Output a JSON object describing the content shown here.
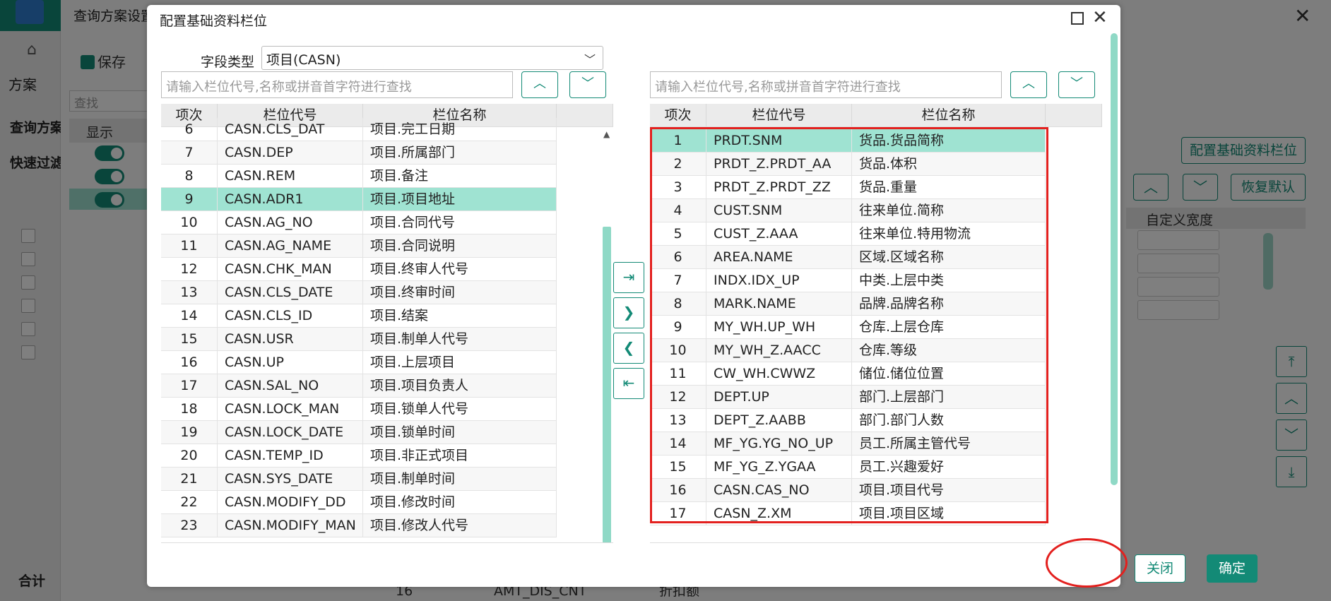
{
  "background": {
    "scheme_label": "方案",
    "window_title": "查询方案设置",
    "save_label": "保存",
    "find_placeholder": "查找",
    "show_header": "显示",
    "query_scheme_label": "查询方案",
    "fast_filter_label": "快速过滤",
    "total_label": "合计",
    "config_button": "配置基础资料栏位",
    "restore_button": "恢复默认",
    "custom_width_header": "自定义宽度",
    "bottom_row": {
      "index": "16",
      "code": "AMT_DIS_CNT",
      "name": "折扣额"
    }
  },
  "dialog": {
    "title": "配置基础资料栏位",
    "field_type_label": "字段类型",
    "field_type_value": "项目(CASN)",
    "search_placeholder": "请输入栏位代号,名称或拼音首字符进行查找",
    "columns": [
      "项次",
      "栏位代号",
      "栏位名称"
    ],
    "left_rows": [
      {
        "idx": "6",
        "code": "CASN.CLS_DAT",
        "name": "项目.完工日期"
      },
      {
        "idx": "7",
        "code": "CASN.DEP",
        "name": "项目.所属部门"
      },
      {
        "idx": "8",
        "code": "CASN.REM",
        "name": "项目.备注"
      },
      {
        "idx": "9",
        "code": "CASN.ADR1",
        "name": "项目.项目地址"
      },
      {
        "idx": "10",
        "code": "CASN.AG_NO",
        "name": "项目.合同代号"
      },
      {
        "idx": "11",
        "code": "CASN.AG_NAME",
        "name": "项目.合同说明"
      },
      {
        "idx": "12",
        "code": "CASN.CHK_MAN",
        "name": "项目.终审人代号"
      },
      {
        "idx": "13",
        "code": "CASN.CLS_DATE",
        "name": "项目.终审时间"
      },
      {
        "idx": "14",
        "code": "CASN.CLS_ID",
        "name": "项目.结案"
      },
      {
        "idx": "15",
        "code": "CASN.USR",
        "name": "项目.制单人代号"
      },
      {
        "idx": "16",
        "code": "CASN.UP",
        "name": "项目.上层项目"
      },
      {
        "idx": "17",
        "code": "CASN.SAL_NO",
        "name": "项目.项目负责人"
      },
      {
        "idx": "18",
        "code": "CASN.LOCK_MAN",
        "name": "项目.锁单人代号"
      },
      {
        "idx": "19",
        "code": "CASN.LOCK_DATE",
        "name": "项目.锁单时间"
      },
      {
        "idx": "20",
        "code": "CASN.TEMP_ID",
        "name": "项目.非正式项目"
      },
      {
        "idx": "21",
        "code": "CASN.SYS_DATE",
        "name": "项目.制单时间"
      },
      {
        "idx": "22",
        "code": "CASN.MODIFY_DD",
        "name": "项目.修改时间"
      },
      {
        "idx": "23",
        "code": "CASN.MODIFY_MAN",
        "name": "项目.修改人代号"
      }
    ],
    "left_selected_index": 3,
    "right_rows": [
      {
        "idx": "1",
        "code": "PRDT.SNM",
        "name": "货品.货品简称"
      },
      {
        "idx": "2",
        "code": "PRDT_Z.PRDT_AA",
        "name": "货品.体积"
      },
      {
        "idx": "3",
        "code": "PRDT_Z.PRDT_ZZ",
        "name": "货品.重量"
      },
      {
        "idx": "4",
        "code": "CUST.SNM",
        "name": "往来单位.简称"
      },
      {
        "idx": "5",
        "code": "CUST_Z.AAA",
        "name": "往来单位.特用物流"
      },
      {
        "idx": "6",
        "code": "AREA.NAME",
        "name": "区域.区域名称"
      },
      {
        "idx": "7",
        "code": "INDX.IDX_UP",
        "name": "中类.上层中类"
      },
      {
        "idx": "8",
        "code": "MARK.NAME",
        "name": "品牌.品牌名称"
      },
      {
        "idx": "9",
        "code": "MY_WH.UP_WH",
        "name": "仓库.上层仓库"
      },
      {
        "idx": "10",
        "code": "MY_WH_Z.AACC",
        "name": "仓库.等级"
      },
      {
        "idx": "11",
        "code": "CW_WH.CWWZ",
        "name": "储位.储位位置"
      },
      {
        "idx": "12",
        "code": "DEPT.UP",
        "name": "部门.上层部门"
      },
      {
        "idx": "13",
        "code": "DEPT_Z.AABB",
        "name": "部门.部门人数"
      },
      {
        "idx": "14",
        "code": "MF_YG.YG_NO_UP",
        "name": "员工.所属主管代号"
      },
      {
        "idx": "15",
        "code": "MF_YG_Z.YGAA",
        "name": "员工.兴趣爱好"
      },
      {
        "idx": "16",
        "code": "CASN.CAS_NO",
        "name": "项目.项目代号"
      },
      {
        "idx": "17",
        "code": "CASN_Z.XM",
        "name": "项目.项目区域"
      }
    ],
    "right_selected_index": 0,
    "close_button": "关闭",
    "ok_button": "确定"
  },
  "colors": {
    "accent": "#138a76",
    "selection": "#9fe3d2",
    "highlight": "#e3201e"
  },
  "icons": {
    "up": "chevron-up-icon",
    "down": "chevron-down-icon",
    "move_all_right": "move-all-right-icon",
    "move_right": "move-right-icon",
    "move_left": "move-left-icon",
    "move_all_left": "move-all-left-icon"
  }
}
